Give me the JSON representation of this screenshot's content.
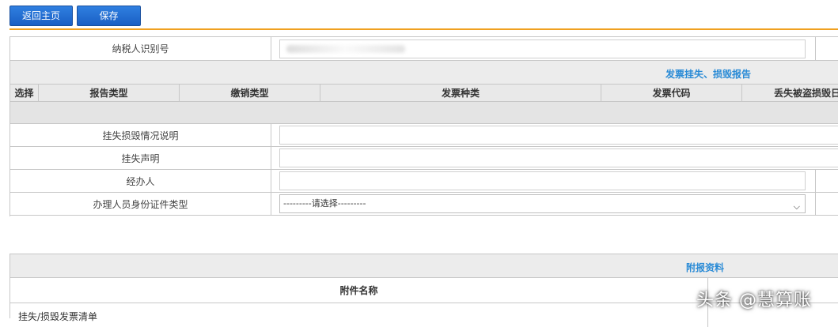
{
  "toolbar": {
    "back_label": "返回主页",
    "save_label": "保存"
  },
  "form": {
    "taxpayer_id_label": "纳税人识别号",
    "taxpayer_id_value": ""
  },
  "report_section": {
    "title": "发票挂失、损毁报告",
    "columns": [
      "选择",
      "报告类型",
      "缴销类型",
      "发票种类",
      "发票代码",
      "丢失被盗损毁日"
    ]
  },
  "details": {
    "situation_label": "挂失损毁情况说明",
    "statement_label": "挂失声明",
    "handler_label": "经办人",
    "id_type_label": "办理人员身份证件类型",
    "id_type_selected": "---------请选择---------"
  },
  "attachments": {
    "title": "附报资料",
    "column_name": "附件名称",
    "rows": [
      "挂失/损毁发票清单"
    ]
  },
  "watermark": "头条 @慧算账"
}
